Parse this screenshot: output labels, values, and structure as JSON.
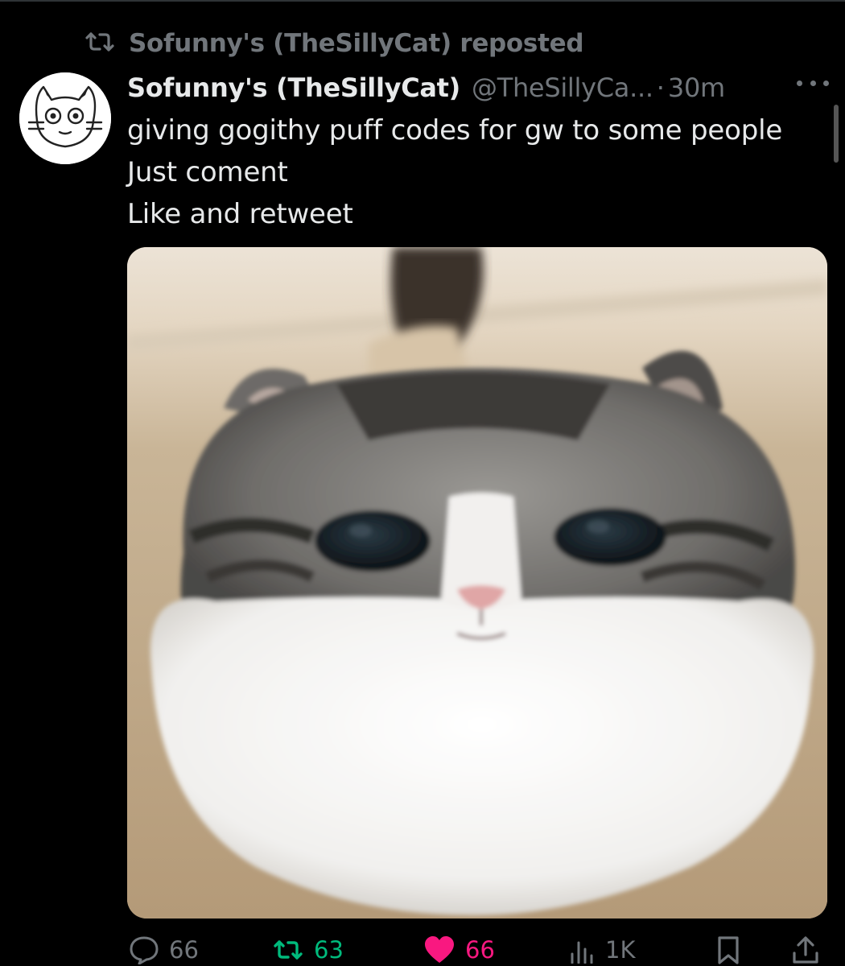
{
  "repost_banner": {
    "text": "Sofunny's (TheSillyCat) reposted"
  },
  "tweet": {
    "display_name": "Sofunny's (TheSillyCat)",
    "handle": "@TheSillyCa...",
    "separator": "·",
    "time": "30m",
    "text_lines": [
      "giving gogithy puff codes for gw to some people",
      "Just coment",
      "Like and retweet"
    ],
    "media_description": "cat photo"
  },
  "actions": {
    "replies": "66",
    "retweets": "63",
    "likes": "66",
    "views": "1K"
  },
  "colors": {
    "background": "#000000",
    "text": "#e7e9ea",
    "muted": "#71767b",
    "retweet_active": "#00ba7c",
    "like_active": "#f91880"
  },
  "icons": [
    "repost-icon",
    "more-icon",
    "reply-icon",
    "retweet-icon",
    "heart-icon",
    "views-icon",
    "bookmark-icon",
    "share-icon"
  ]
}
